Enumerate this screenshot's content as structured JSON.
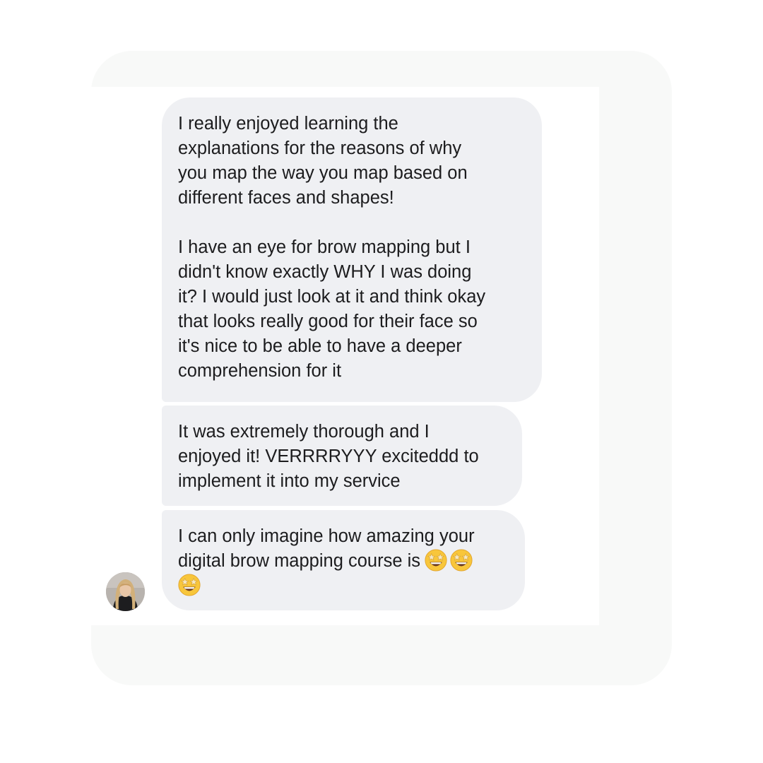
{
  "messages": [
    {
      "paragraphs": [
        "I really enjoyed learning the\nexplanations for the reasons of why\nyou map the way you map based on\ndifferent faces and shapes!",
        "I have an eye for brow mapping but I\ndidn't know exactly WHY I was doing\nit? I would just look at it and think okay\nthat looks really good for their face so\nit's nice to be able to have a deeper\ncomprehension for it"
      ]
    },
    {
      "text": "It was extremely thorough and I\nenjoyed it! VERRRRYYY exciteddd to\nimplement it into my service"
    },
    {
      "text_line1": "I can only imagine how amazing your",
      "text_line2": "digital brow mapping course is",
      "emojis": [
        "star-struck",
        "star-struck",
        "star-struck"
      ]
    }
  ],
  "colors": {
    "bubble_background": "#eff0f3",
    "text": "#1c1c1e",
    "frame": "#f8f9f8"
  }
}
